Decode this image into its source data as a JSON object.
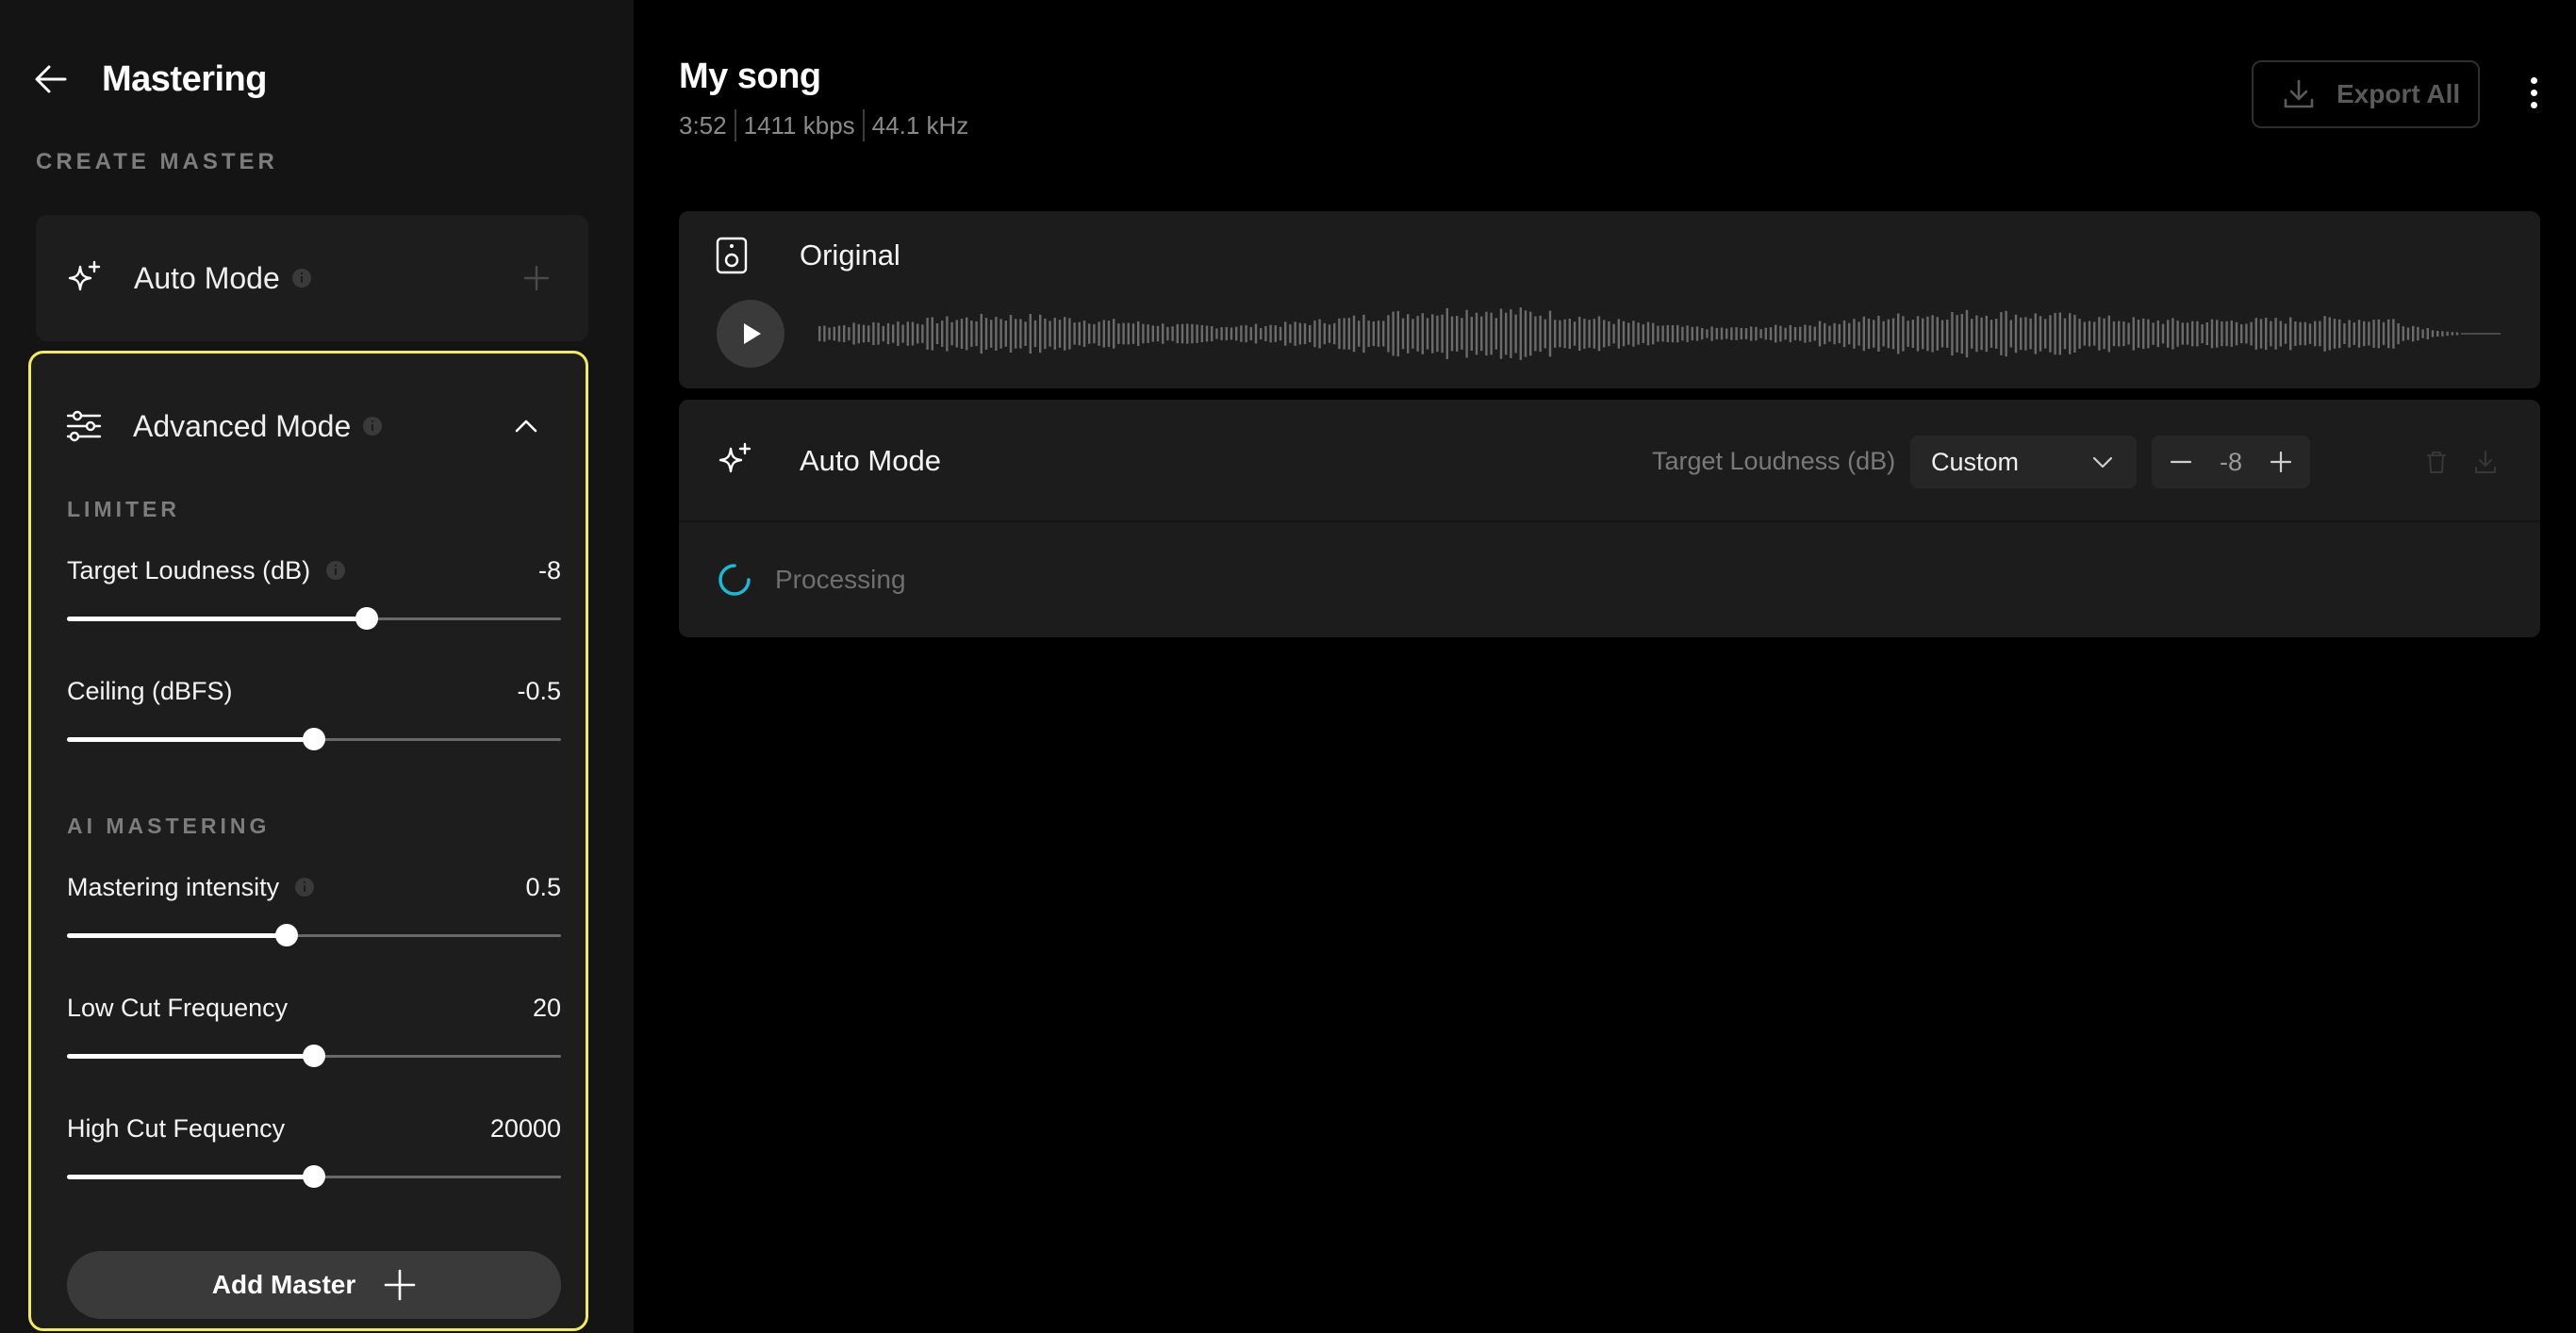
{
  "sidebar": {
    "title": "Mastering",
    "create_label": "CREATE MASTER",
    "auto_mode": {
      "label": "Auto Mode"
    },
    "advanced_mode": {
      "label": "Advanced Mode",
      "limiter_label": "LIMITER",
      "ai_label": "AI MASTERING",
      "sliders": [
        {
          "label": "Target Loudness (dB)",
          "value": "-8",
          "fraction": 0.607
        },
        {
          "label": "Ceiling (dBFS)",
          "value": "-0.5",
          "fraction": 0.5
        },
        {
          "label": "Mastering intensity",
          "value": "0.5",
          "fraction": 0.445
        },
        {
          "label": "Low Cut Frequency",
          "value": "20",
          "fraction": 0.5
        },
        {
          "label": "High Cut Fequency",
          "value": "20000",
          "fraction": 0.5
        }
      ],
      "add_master_label": "Add Master"
    }
  },
  "song": {
    "title": "My song",
    "duration": "3:52",
    "bitrate": "1411 kbps",
    "sample_rate": "44.1 kHz"
  },
  "toolbar": {
    "export_label": "Export All"
  },
  "original": {
    "title": "Original"
  },
  "auto_panel": {
    "title": "Auto Mode",
    "target_loudness_label": "Target Loudness (dB)",
    "preset_value": "Custom",
    "loudness_value": "-8",
    "status": "Processing"
  },
  "colors": {
    "accent_border": "#f3ea5d",
    "spinner": "#1fb8d4",
    "sidebar_bg": "#141414",
    "card_bg": "#1d1d1d"
  },
  "icons": {
    "back": "arrow-left-icon",
    "auto": "sparkles-icon",
    "advanced": "sliders-icon",
    "info": "info-icon",
    "export": "download-icon",
    "more": "more-vertical-icon",
    "original": "speaker-icon",
    "play": "play-icon"
  }
}
